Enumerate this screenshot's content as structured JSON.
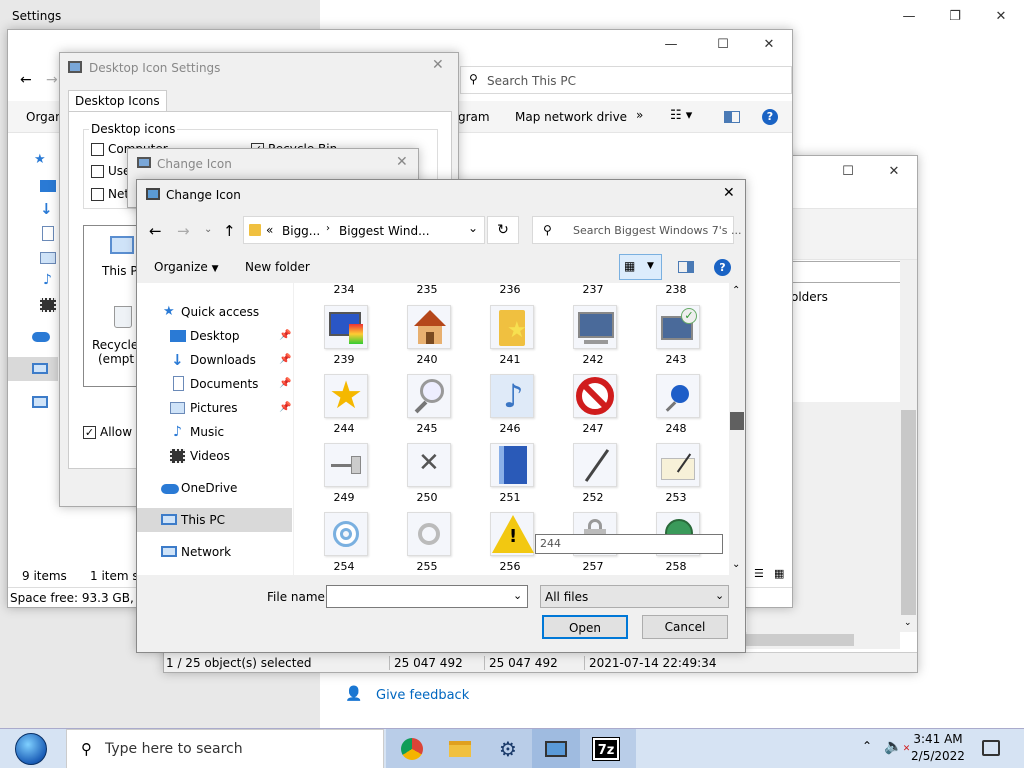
{
  "settings": {
    "title": "Settings",
    "feedback": "Give feedback",
    "bg_input_text": "olders"
  },
  "explorer": {
    "search_placeholder": "Search This PC",
    "toolbar": {
      "organize": "Organ",
      "program": "gram",
      "map_drive": "Map network drive",
      "more": "»"
    },
    "status": {
      "items": "9 items",
      "selected": "1 item sele",
      "space": "Space free: 93.3 GB, Tota"
    }
  },
  "archive": {
    "status": {
      "selected": "1 / 25 object(s) selected",
      "size1": "25 047 492",
      "size2": "25 047 492",
      "date": "2021-07-14 22:49:34"
    }
  },
  "desktop_icon_settings": {
    "title": "Desktop Icon Settings",
    "tab": "Desktop Icons",
    "group": "Desktop icons",
    "checks": {
      "computer": "Computer",
      "recycle": "Recycle Bin",
      "user": "User",
      "network": "Netw"
    },
    "icons": {
      "thispc": "This P",
      "recycle": "Recycle",
      "recycle2": "(empt"
    },
    "allow": "Allow t"
  },
  "change_icon_back": {
    "title": "Change Icon"
  },
  "change_icon": {
    "title": "Change Icon",
    "breadcrumb": {
      "prefix": "«",
      "part1": "Bigg...",
      "part2": "Biggest Wind..."
    },
    "search_placeholder": "Search Biggest Windows 7's ...",
    "organize": "Organize",
    "new_folder": "New folder",
    "nav": {
      "quick_access": "Quick access",
      "desktop": "Desktop",
      "downloads": "Downloads",
      "documents": "Documents",
      "pictures": "Pictures",
      "music": "Music",
      "videos": "Videos",
      "onedrive": "OneDrive",
      "thispc": "This PC",
      "network": "Network"
    },
    "top_labels": [
      "234",
      "235",
      "236",
      "237",
      "238"
    ],
    "rows": [
      [
        {
          "label": "239",
          "icon": "paint-monitor-icon"
        },
        {
          "label": "240",
          "icon": "house-icon"
        },
        {
          "label": "241",
          "icon": "star-folder-icon"
        },
        {
          "label": "242",
          "icon": "monitor-icon"
        },
        {
          "label": "243",
          "icon": "monitor-check-icon"
        }
      ],
      [
        {
          "label": "244",
          "icon": "star-icon"
        },
        {
          "label": "245",
          "icon": "magnifier-icon"
        },
        {
          "label": "246",
          "icon": "music-note-icon"
        },
        {
          "label": "247",
          "icon": "no-entry-icon"
        },
        {
          "label": "248",
          "icon": "pushpin-icon"
        }
      ],
      [
        {
          "label": "249",
          "icon": "pin-side-icon"
        },
        {
          "label": "250",
          "icon": "x-mark-icon"
        },
        {
          "label": "251",
          "icon": "blue-book-icon"
        },
        {
          "label": "252",
          "icon": "pen-icon"
        },
        {
          "label": "253",
          "icon": "signature-icon"
        }
      ],
      [
        {
          "label": "254",
          "icon": "target-ring-icon"
        },
        {
          "label": "255",
          "icon": "ring-icon"
        },
        {
          "label": "256",
          "icon": "warning-icon"
        },
        {
          "label": "257",
          "icon": "lock-icon"
        },
        {
          "label": "258",
          "icon": "globe-icon"
        }
      ]
    ],
    "tooltip": "244",
    "file_name_label": "File name:",
    "file_name_value": "",
    "filter": "All files",
    "open": "Open",
    "cancel": "Cancel"
  },
  "taskbar": {
    "search_placeholder": "Type here to search",
    "time": "3:41 AM",
    "date": "2/5/2022",
    "apps": [
      "chrome-icon",
      "file-explorer-icon",
      "settings-gear-icon",
      "icon-changer-icon",
      "7zip-icon"
    ],
    "seven_zip_text": "7z"
  }
}
